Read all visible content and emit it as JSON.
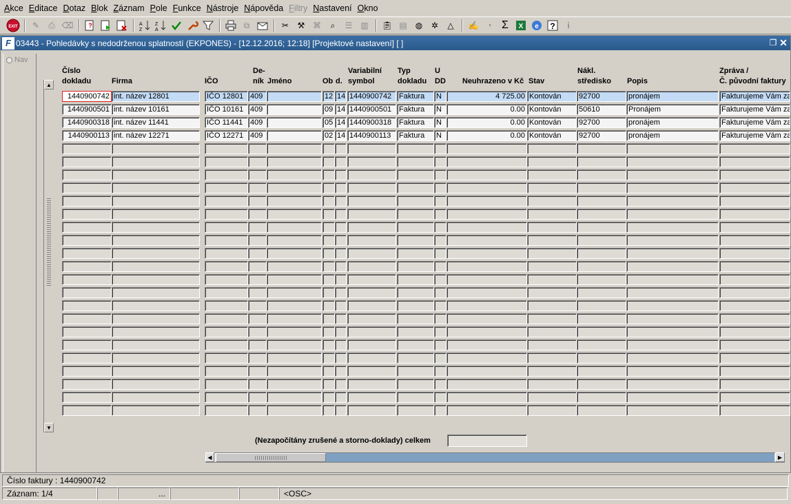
{
  "menu": [
    "Akce",
    "Editace",
    "Dotaz",
    "Blok",
    "Záznam",
    "Pole",
    "Funkce",
    "Nástroje",
    "Nápověda",
    "Filtry",
    "Nastavení",
    "Okno"
  ],
  "window": {
    "title": "03443 - Pohledávky s nedodrženou splatností (EKPONES) - [12.12.2016; 12:18]  [Projektové nastavení]  [ ]",
    "logo": "F"
  },
  "nav": {
    "label": "Nav"
  },
  "columns": [
    {
      "key": "cislo",
      "l1": "Číslo",
      "l2": "dokladu"
    },
    {
      "key": "firma",
      "l1": "",
      "l2": "Firma"
    },
    {
      "key": "ico",
      "l1": "",
      "l2": "IČO"
    },
    {
      "key": "denik",
      "l1": "De-",
      "l2": "ník"
    },
    {
      "key": "jmeno",
      "l1": "",
      "l2": "Jméno"
    },
    {
      "key": "ob",
      "l1": "",
      "l2": "Ob"
    },
    {
      "key": "d",
      "l1": "",
      "l2": "d."
    },
    {
      "key": "vs",
      "l1": "Variabilní",
      "l2": "symbol"
    },
    {
      "key": "typ",
      "l1": "Typ",
      "l2": "dokladu"
    },
    {
      "key": "udd",
      "l1": "U",
      "l2": "DD"
    },
    {
      "key": "neuhr",
      "l1": "",
      "l2": "Neuhrazeno v Kč"
    },
    {
      "key": "stav",
      "l1": "",
      "l2": "Stav"
    },
    {
      "key": "nakl",
      "l1": "Nákl.",
      "l2": "středisko"
    },
    {
      "key": "popis",
      "l1": "",
      "l2": "Popis"
    },
    {
      "key": "zprava",
      "l1": "Zpráva /",
      "l2": "Č. původní faktury"
    }
  ],
  "rows": [
    {
      "cislo": "1440900742",
      "firma": "int. název 12801",
      "ico": "IČO 12801",
      "denik": "409",
      "jmeno": "",
      "ob": "12",
      "d": "14",
      "vs": "1440900742",
      "typ": "Faktura",
      "udd": "N",
      "neuhr": "4 725.00",
      "stav": "Kontován",
      "nakl": "92700",
      "popis": "pronájem",
      "zprava": "Fakturujeme Vám za"
    },
    {
      "cislo": "1440900501",
      "firma": "int. název 10161",
      "ico": "IČO 10161",
      "denik": "409",
      "jmeno": "",
      "ob": "09",
      "d": "14",
      "vs": "1440900501",
      "typ": "Faktura",
      "udd": "N",
      "neuhr": "0.00",
      "stav": "Kontován",
      "nakl": "50610",
      "popis": "Pronájem",
      "zprava": "Fakturujeme Vám za"
    },
    {
      "cislo": "1440900318",
      "firma": "int. název 11441",
      "ico": "IČO 11441",
      "denik": "409",
      "jmeno": "",
      "ob": "05",
      "d": "14",
      "vs": "1440900318",
      "typ": "Faktura",
      "udd": "N",
      "neuhr": "0.00",
      "stav": "Kontován",
      "nakl": "92700",
      "popis": "pronájem",
      "zprava": "Fakturujeme Vám za"
    },
    {
      "cislo": "1440900113",
      "firma": "int. název 12271",
      "ico": "IČO 12271",
      "denik": "409",
      "jmeno": "",
      "ob": "02",
      "d": "14",
      "vs": "1440900113",
      "typ": "Faktura",
      "udd": "N",
      "neuhr": "0.00",
      "stav": "Kontován",
      "nakl": "92700",
      "popis": "pronájem",
      "zprava": "Fakturujeme Vám za"
    }
  ],
  "empty_rows": 21,
  "total": {
    "label": "(Nezapočítány zrušené a storno-doklady) celkem",
    "value": ""
  },
  "status": {
    "field": "Číslo faktury : 1440900742",
    "record": "Záznam: 1/4",
    "seg2": "",
    "seg3": "...",
    "seg4": "",
    "seg5": "",
    "mode": "<OSC>"
  },
  "toolbar_icons": [
    "exit-icon",
    "sep",
    "pen-icon",
    "print-preview-icon",
    "eraser-icon",
    "sep",
    "query-enter-icon",
    "query-execute-icon",
    "query-cancel-icon",
    "sep",
    "sort-asc-icon",
    "sort-desc-icon",
    "check-icon",
    "wrench-icon",
    "filter-icon",
    "sep",
    "print-icon",
    "copy-icon",
    "mail-icon",
    "sep",
    "cut-icon",
    "tools-icon",
    "tree-icon",
    "tree-search-icon",
    "list-icon",
    "columns-icon",
    "sep",
    "clipboard-icon",
    "document-icon",
    "globe-icon",
    "settings-icon",
    "triangle-icon",
    "sep",
    "edit-icon",
    "clock-icon",
    "sum-icon",
    "excel-icon",
    "ie-icon",
    "help-icon",
    "info-icon"
  ]
}
